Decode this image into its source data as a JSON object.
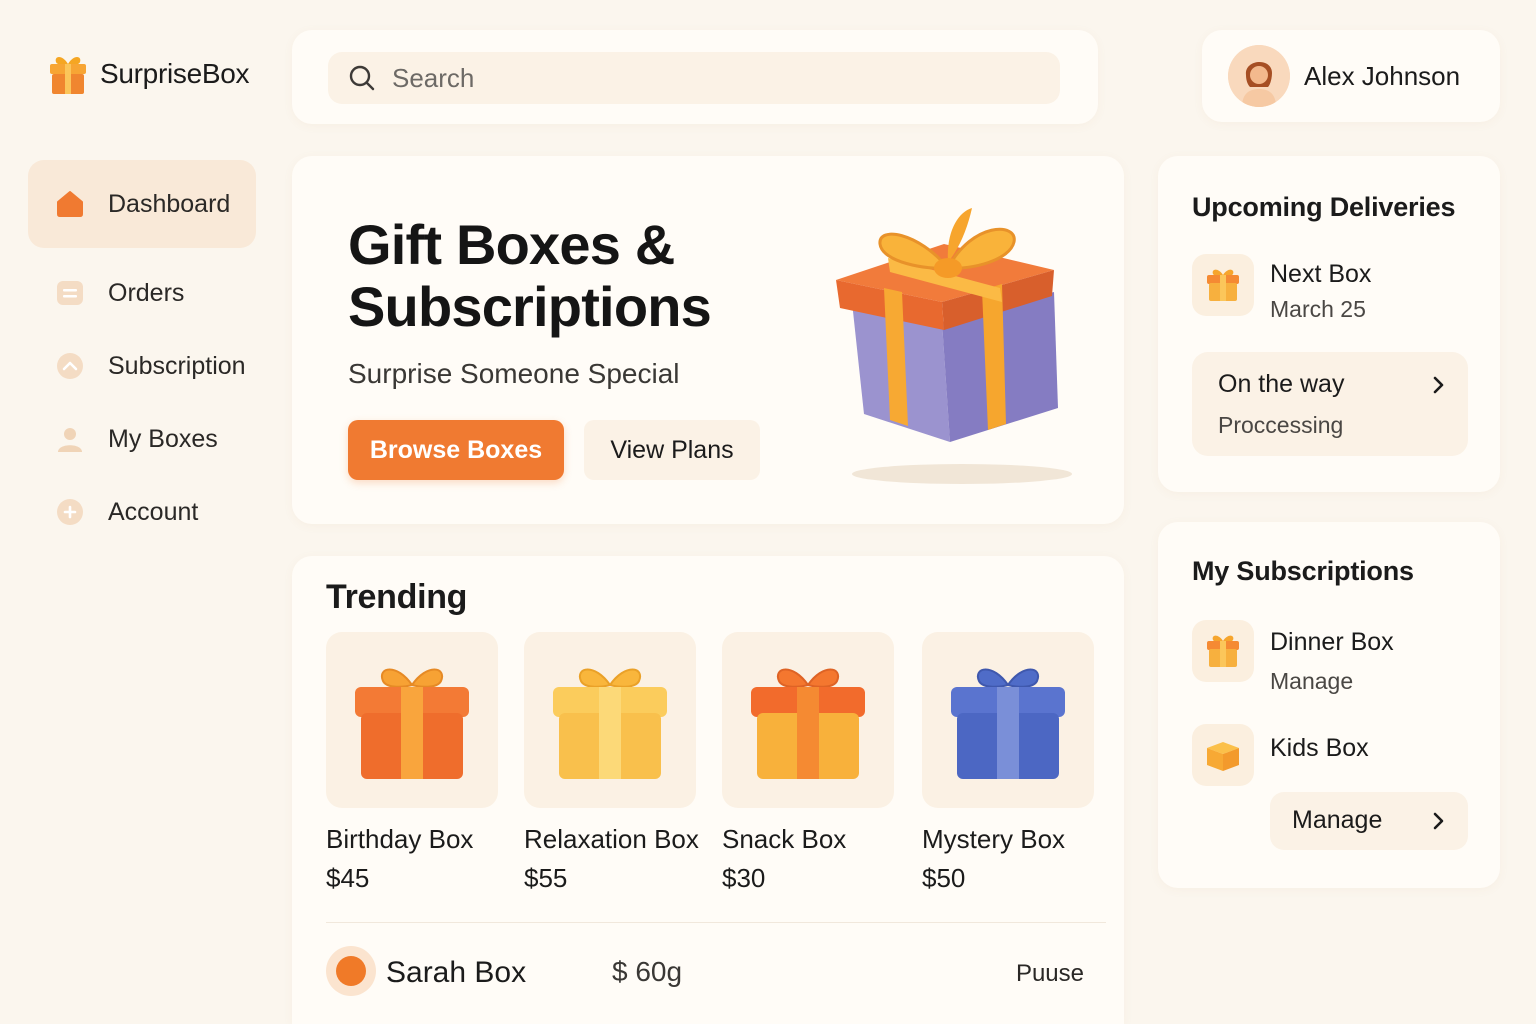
{
  "app": {
    "name": "SurpriseBox"
  },
  "search": {
    "placeholder": "Search"
  },
  "user": {
    "name": "Alex Johnson"
  },
  "sidebar": {
    "items": [
      {
        "label": "Dashboard",
        "icon": "home-icon",
        "active": true
      },
      {
        "label": "Orders",
        "icon": "orders-icon",
        "active": false
      },
      {
        "label": "Subscription",
        "icon": "subscription-icon",
        "active": false
      },
      {
        "label": "My Boxes",
        "icon": "user-icon",
        "active": false
      },
      {
        "label": "Account",
        "icon": "plus-circle-icon",
        "active": false
      }
    ]
  },
  "hero": {
    "title": "Gift Boxes & Subscriptions",
    "subtitle": "Surprise Someone Special",
    "primary_button": "Browse Boxes",
    "secondary_button": "View Plans"
  },
  "trending": {
    "title": "Trending",
    "items": [
      {
        "name": "Birthday Box",
        "price": "$45",
        "color": "orange"
      },
      {
        "name": "Relaxation Box",
        "price": "$55",
        "color": "yellow"
      },
      {
        "name": "Snack Box",
        "price": "$30",
        "color": "orange-yellow"
      },
      {
        "name": "Mystery Box",
        "price": "$50",
        "color": "blue"
      }
    ],
    "row": {
      "name": "Sarah Box",
      "price": "$ 60g",
      "status": "Puuse"
    }
  },
  "deliveries": {
    "title": "Upcoming Deliveries",
    "next": {
      "name": "Next Box",
      "date": "March 25"
    },
    "status": {
      "title": "On the way",
      "sub": "Proccessing"
    }
  },
  "subscriptions": {
    "title": "My Subscriptions",
    "items": [
      {
        "name": "Dinner Box",
        "action": "Manage"
      },
      {
        "name": "Kids Box"
      }
    ],
    "manage_button": "Manage"
  },
  "colors": {
    "accent": "#f07a31",
    "background": "#fbf6ee",
    "card": "#fffcf7"
  }
}
